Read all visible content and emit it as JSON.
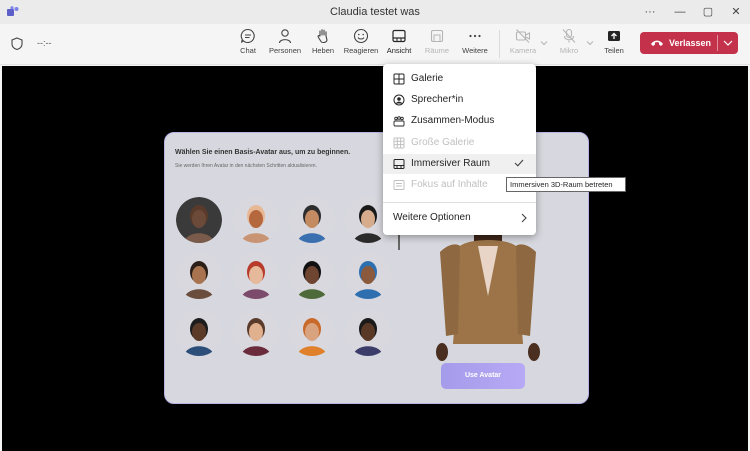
{
  "window": {
    "title": "Claudia testet was",
    "more": "···",
    "minimize": "—",
    "maximize": "▢",
    "close": "✕"
  },
  "meeting": {
    "timer": "--:--"
  },
  "toolbar": {
    "chat": "Chat",
    "people": "Personen",
    "raise": "Heben",
    "react": "Reagieren",
    "view": "Ansicht",
    "rooms": "Räume",
    "more": "Weitere",
    "camera": "Kamera",
    "mic": "Mikro",
    "share": "Teilen",
    "leave": "Verlassen"
  },
  "view_menu": {
    "items": [
      {
        "label": "Galerie",
        "icon": "grid-icon",
        "enabled": true
      },
      {
        "label": "Sprecher*in",
        "icon": "speaker-icon",
        "enabled": true
      },
      {
        "label": "Zusammen-Modus",
        "icon": "together-mode-icon",
        "enabled": true
      },
      {
        "label": "Große Galerie",
        "icon": "large-gallery-icon",
        "enabled": false
      },
      {
        "label": "Immersiver Raum",
        "icon": "immersive-room-icon",
        "enabled": true,
        "checked": true
      },
      {
        "label": "Fokus auf Inhalte",
        "icon": "focus-content-icon",
        "enabled": false
      }
    ],
    "more_options": "Weitere Optionen"
  },
  "tooltip": "Immersiven 3D-Raum betreten",
  "avatar_panel": {
    "heading": "Wählen Sie einen Basis-Avatar aus, um zu beginnen.",
    "subheading": "Sie werden Ihren Avatar in den nächsten Schritten aktualisieren.",
    "use_button": "Use Avatar"
  },
  "colors": {
    "leave": "#c4314b",
    "panel": "#d7d8df",
    "accent": "#a49bea"
  }
}
